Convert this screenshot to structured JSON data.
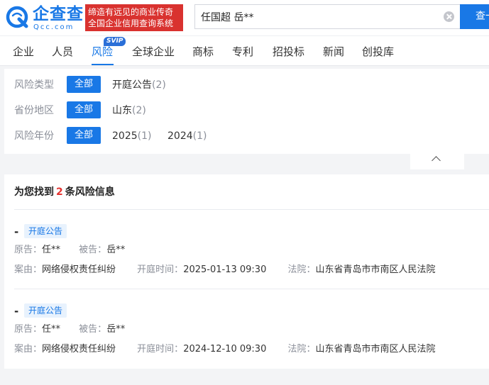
{
  "header": {
    "logo_name": "企查查",
    "logo_sub": "Qcc.com",
    "slogan_line1": "缔造有远见的商业传奇",
    "slogan_line2": "全国企业信用查询系统",
    "search_value": "任国超 岳**",
    "search_button": "查一"
  },
  "nav": {
    "items": [
      "企业",
      "人员",
      "风险",
      "全球企业",
      "商标",
      "专利",
      "招投标",
      "新闻",
      "创投库"
    ],
    "active": "风险",
    "badge": "SVIP"
  },
  "filters": {
    "rows": [
      {
        "label": "风险类型",
        "all": "全部",
        "options": [
          {
            "name": "开庭公告",
            "count": "(2)"
          }
        ]
      },
      {
        "label": "省份地区",
        "all": "全部",
        "options": [
          {
            "name": "山东",
            "count": "(2)"
          }
        ]
      },
      {
        "label": "风险年份",
        "all": "全部",
        "options": [
          {
            "name": "2025",
            "count": "(1)"
          },
          {
            "name": "2024",
            "count": "(1)"
          }
        ]
      }
    ]
  },
  "results": {
    "title_prefix": "为您找到",
    "count": "2",
    "title_suffix": "条风险信息",
    "items": [
      {
        "dash": "-",
        "tag": "开庭公告",
        "plaintiff_label": "原告：",
        "plaintiff": "任**",
        "defendant_label": "被告：",
        "defendant": "岳**",
        "cause_label": "案由：",
        "cause": "网络侵权责任纠纷",
        "time_label": "开庭时间：",
        "time": "2025-01-13 09:30",
        "court_label": "法院：",
        "court": "山东省青岛市市南区人民法院"
      },
      {
        "dash": "-",
        "tag": "开庭公告",
        "plaintiff_label": "原告：",
        "plaintiff": "任**",
        "defendant_label": "被告：",
        "defendant": "岳**",
        "cause_label": "案由：",
        "cause": "网络侵权责任纠纷",
        "time_label": "开庭时间：",
        "time": "2024-12-10 09:30",
        "court_label": "法院：",
        "court": "山东省青岛市市南区人民法院"
      }
    ]
  },
  "colors": {
    "brand": "#1978e6",
    "slogan_bg": "#d9322f",
    "count_red": "#e5322f",
    "tag_bg": "#e8f2fd"
  }
}
